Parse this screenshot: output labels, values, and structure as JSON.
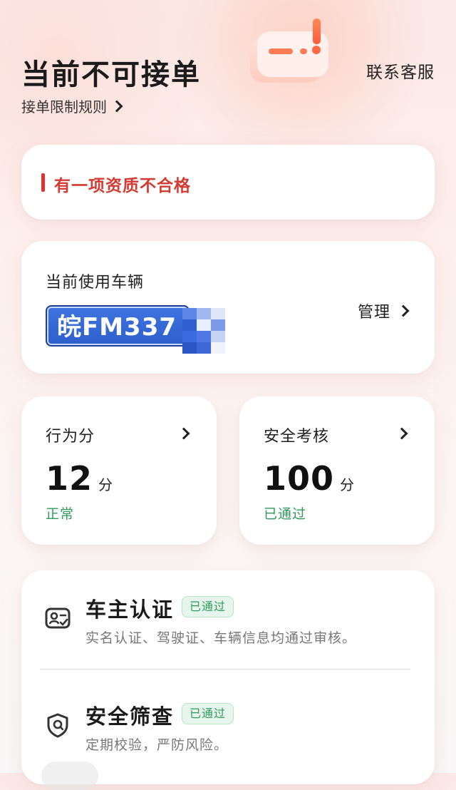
{
  "header": {
    "title": "当前不可接单",
    "rules_link": "接单限制规则",
    "contact": "联系客服"
  },
  "alert": {
    "text": "有一项资质不合格",
    "color": "#d33a32"
  },
  "vehicle": {
    "label": "当前使用车辆",
    "plate": "皖FM337",
    "manage": "管理"
  },
  "scores": [
    {
      "title": "行为分",
      "value": "12",
      "unit": "分",
      "status": "正常"
    },
    {
      "title": "安全考核",
      "value": "100",
      "unit": "分",
      "status": "已通过"
    }
  ],
  "certifications": [
    {
      "title": "车主认证",
      "badge": "已通过",
      "desc": "实名认证、驾驶证、车辆信息均通过审核。",
      "icon": "id-card-icon"
    },
    {
      "title": "安全筛查",
      "badge": "已通过",
      "desc": "定期校验，严防风险。",
      "icon": "shield-pin-icon"
    }
  ],
  "colors": {
    "status_green": "#2f9a5a",
    "plate_blue": "#2d5fcc"
  }
}
